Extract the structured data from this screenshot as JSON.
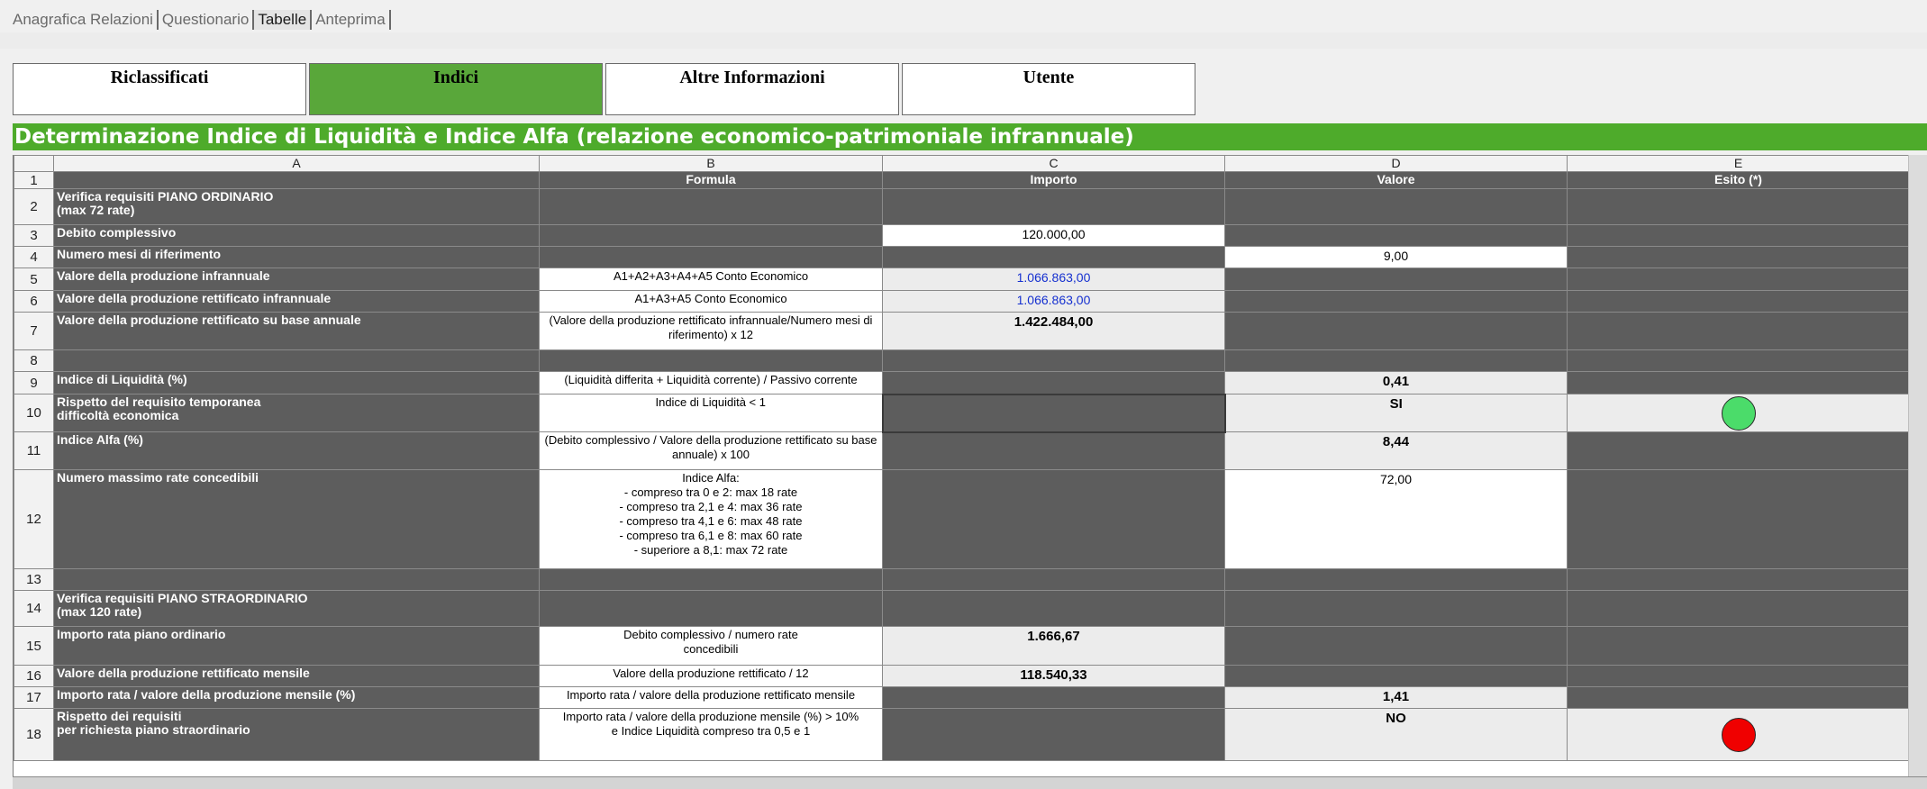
{
  "top_tabs": [
    {
      "label": "Anagrafica Relazioni"
    },
    {
      "label": "Questionario"
    },
    {
      "label": "Tabelle"
    },
    {
      "label": "Anteprima"
    }
  ],
  "section_tabs": [
    {
      "label": "Riclassificati"
    },
    {
      "label": "Indici"
    },
    {
      "label": "Altre Informazioni"
    },
    {
      "label": "Utente"
    }
  ],
  "title": "Determinazione Indice di Liquidità e Indice Alfa (relazione economico-patrimoniale infrannuale)",
  "columns": [
    "A",
    "B",
    "C",
    "D",
    "E"
  ],
  "header_row": {
    "num": "1",
    "a": "",
    "b": "Formula",
    "c": "Importo",
    "d": "Valore",
    "e": "Esito (*)"
  },
  "rows": {
    "r2": {
      "num": "2",
      "a": "Verifica requisiti PIANO ORDINARIO\n(max 72 rate)"
    },
    "r3": {
      "num": "3",
      "a": "Debito complessivo",
      "c": "120.000,00"
    },
    "r4": {
      "num": "4",
      "a": "Numero mesi di riferimento",
      "d": "9,00"
    },
    "r5": {
      "num": "5",
      "a": "Valore della produzione infrannuale",
      "b": "A1+A2+A3+A4+A5 Conto Economico",
      "c": "1.066.863,00"
    },
    "r6": {
      "num": "6",
      "a": "Valore della produzione rettificato infrannuale",
      "b": "A1+A3+A5 Conto Economico",
      "c": "1.066.863,00"
    },
    "r7": {
      "num": "7",
      "a": "Valore della produzione rettificato su base annuale",
      "b": "(Valore della produzione rettificato infrannuale/Numero mesi di riferimento) x 12",
      "c": "1.422.484,00"
    },
    "r8": {
      "num": "8"
    },
    "r9": {
      "num": "9",
      "a": "Indice di Liquidità (%)",
      "b": "(Liquidità differita + Liquidità corrente) / Passivo corrente",
      "d": "0,41"
    },
    "r10": {
      "num": "10",
      "a": "Rispetto del requisito temporanea\n difficoltà economica",
      "b": "Indice di Liquidità < 1",
      "d": "SI",
      "e_status": "green"
    },
    "r11": {
      "num": "11",
      "a": "Indice Alfa (%)",
      "b": "(Debito complessivo / Valore della produzione rettificato su base annuale) x 100",
      "d": "8,44"
    },
    "r12": {
      "num": "12",
      "a": "Numero massimo rate concedibili",
      "b": "Indice Alfa:\n- compreso tra 0 e 2: max 18 rate\n- compreso tra 2,1 e 4: max 36 rate\n- compreso tra 4,1 e 6: max 48 rate\n- compreso tra 6,1 e 8: max 60 rate\n- superiore a 8,1: max 72 rate",
      "d": "72,00"
    },
    "r13": {
      "num": "13"
    },
    "r14": {
      "num": "14",
      "a": "Verifica requisiti PIANO STRAORDINARIO\n(max 120 rate)"
    },
    "r15": {
      "num": "15",
      "a": "Importo rata piano ordinario",
      "b": "Debito complessivo / numero rate\nconcedibili",
      "c": "1.666,67"
    },
    "r16": {
      "num": "16",
      "a": "Valore della produzione rettificato mensile",
      "b": "Valore della produzione rettificato / 12",
      "c": "118.540,33"
    },
    "r17": {
      "num": "17",
      "a": "Importo rata / valore della produzione mensile (%)",
      "b": "Importo rata / valore della produzione rettificato mensile",
      "d": "1,41"
    },
    "r18": {
      "num": "18",
      "a": "Rispetto dei requisiti\nper richiesta piano straordinario",
      "b": "Importo rata / valore della produzione mensile (%) > 10%\ne Indice Liquidità compreso tra 0,5 e 1",
      "d": "NO",
      "e_status": "red"
    }
  },
  "colors": {
    "accent_green": "#4eab2b",
    "tab_active": "#59a73a",
    "cell_dark": "#5d5d5d",
    "status_green": "#4bdc6a",
    "status_red": "#f00000",
    "value_blue": "#1530d0"
  }
}
